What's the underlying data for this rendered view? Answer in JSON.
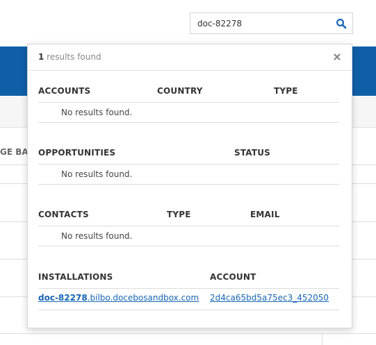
{
  "search": {
    "query": "doc-82278",
    "button_icon": "search-icon",
    "icon_color": "#1565b5"
  },
  "background": {
    "column_header_fragment": "GE BAS",
    "accent_color": "#0f5fa8"
  },
  "results": {
    "count": "1",
    "count_suffix": " results found",
    "close_icon": "close-icon",
    "no_results_text": "No results found.",
    "accounts": {
      "headers": [
        "ACCOUNTS",
        "COUNTRY",
        "TYPE"
      ]
    },
    "opportunities": {
      "headers": [
        "OPPORTUNITIES",
        "STATUS"
      ]
    },
    "contacts": {
      "headers": [
        "CONTACTS",
        "TYPE",
        "EMAIL"
      ]
    },
    "installations": {
      "headers": [
        "INSTALLATIONS",
        "ACCOUNT"
      ],
      "rows": [
        {
          "host_match": "doc-82278",
          "host_rest": ".bilbo.docebosandbox.com",
          "account": "2d4ca65bd5a75ec3_452050"
        }
      ]
    }
  }
}
